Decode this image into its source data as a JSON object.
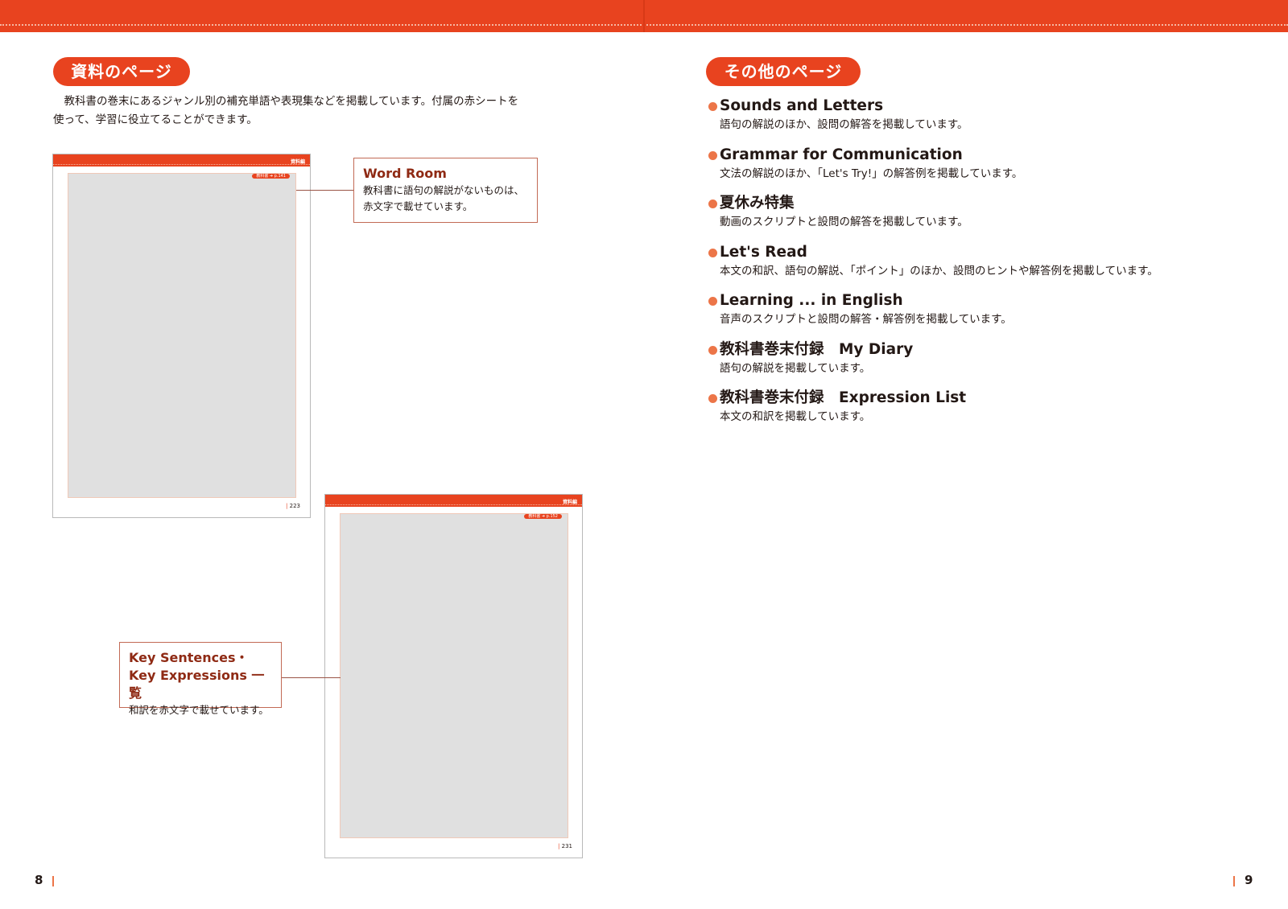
{
  "left_page": {
    "heading": "資料のページ",
    "intro": "　教科書の巻末にあるジャンル別の補充単語や表現集などを掲載しています。付属の赤シートを使って、学習に役立てることができます。",
    "page_number": "8",
    "thumbnail_1": {
      "tab": "資料編",
      "tag": "教科書 ➔ p.141",
      "page": "223"
    },
    "thumbnail_2": {
      "tab": "資料編",
      "tag": "教科書 ➔ p.152",
      "page": "231"
    },
    "callout_word_room": {
      "title": "Word Room",
      "text_line1": "教科書に語句の解説がないものは、",
      "text_line2": "赤文字で載せています。"
    },
    "callout_key": {
      "title_line1": "Key Sentences・",
      "title_line2": "Key Expressions 一覧",
      "text": "和訳を赤文字で載せています。"
    }
  },
  "right_page": {
    "heading": "その他のページ",
    "page_number": "9",
    "items": [
      {
        "title": "Sounds and Letters",
        "description": "語句の解説のほか、設問の解答を掲載しています。"
      },
      {
        "title": "Grammar for Communication",
        "description": "文法の解説のほか、「Let's Try!」の解答例を掲載しています。"
      },
      {
        "title": "夏休み特集",
        "description": "動画のスクリプトと設問の解答を掲載しています。"
      },
      {
        "title": "Let's Read",
        "description": "本文の和訳、語句の解説、「ポイント」のほか、設問のヒントや解答例を掲載しています。"
      },
      {
        "title": "Learning ... in English",
        "description": "音声のスクリプトと設問の解答・解答例を掲載しています。"
      },
      {
        "title": "教科書巻末付録　My Diary",
        "description": "語句の解説を掲載しています。"
      },
      {
        "title": "教科書巻末付録　Expression List",
        "description": "本文の和訳を掲載しています。"
      }
    ]
  },
  "colors": {
    "accent": "#e8431f",
    "bullet": "#ec7548",
    "callout_title": "#8f2a14",
    "placeholder": "#e0e0e0"
  }
}
